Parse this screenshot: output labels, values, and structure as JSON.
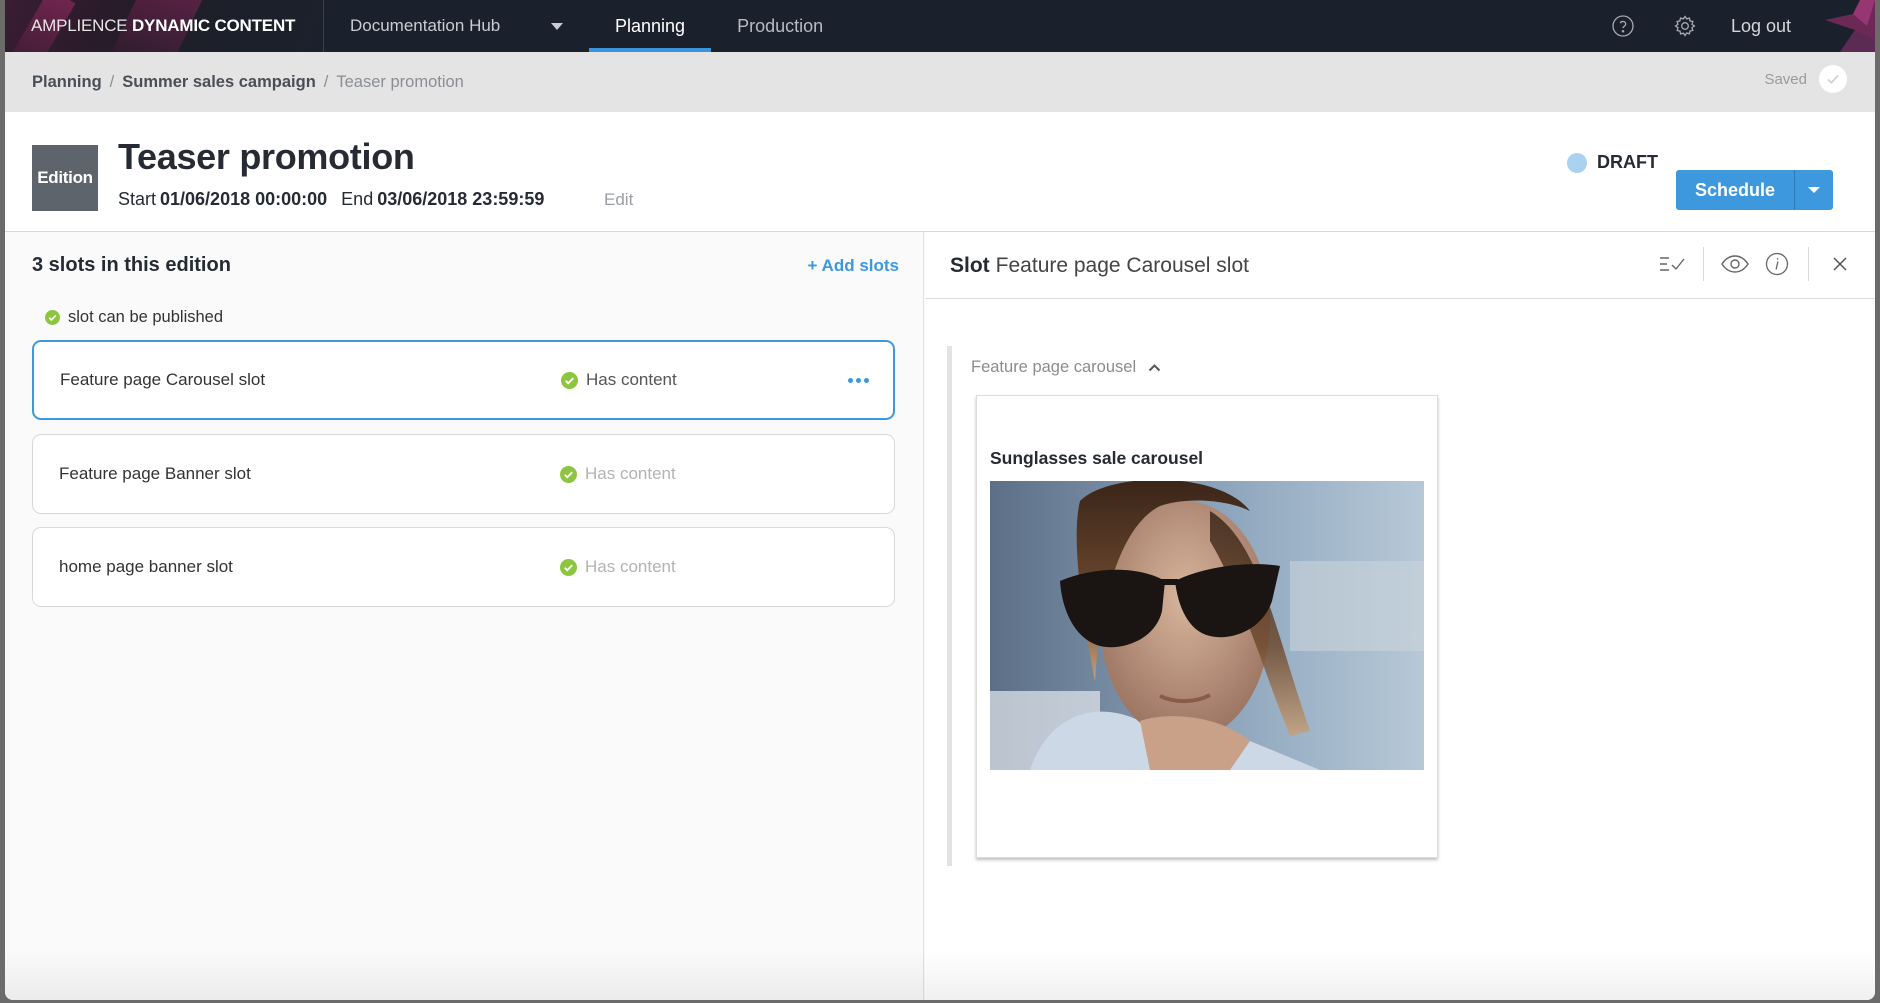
{
  "topnav": {
    "brand_light": "AMPLIENCE",
    "brand_bold": "DYNAMIC CONTENT",
    "hub_name": "Documentation Hub",
    "tabs": [
      {
        "label": "Planning",
        "active": true
      },
      {
        "label": "Production",
        "active": false
      }
    ],
    "help_icon": "help-circle-icon",
    "settings_icon": "gear-icon",
    "logout_label": "Log out"
  },
  "breadcrumb": {
    "items": [
      "Planning",
      "Summer sales campaign",
      "Teaser promotion"
    ],
    "separator": "/",
    "saved_label": "Saved"
  },
  "edition": {
    "badge": "Edition",
    "title": "Teaser promotion",
    "start_label": "Start",
    "start_value": "01/06/2018 00:00:00",
    "end_label": "End",
    "end_value": "03/06/2018 23:59:59",
    "edit_label": "Edit",
    "status": "DRAFT",
    "status_color": "#a8d2ef",
    "schedule_label": "Schedule",
    "accent_color": "#3d98de"
  },
  "slots_panel": {
    "title": "3 slots in this edition",
    "add_label": "+ Add slots",
    "publish_note": "slot can be published",
    "slots": [
      {
        "name": "Feature page Carousel slot",
        "status": "Has content",
        "selected": true
      },
      {
        "name": "Feature page Banner slot",
        "status": "Has content",
        "selected": false
      },
      {
        "name": "home page banner slot",
        "status": "Has content",
        "selected": false
      }
    ]
  },
  "slot_detail": {
    "label": "Slot",
    "name": "Feature page Carousel slot",
    "content_type_label": "Feature page carousel",
    "content_title": "Sunglasses sale carousel",
    "image_alt": "Woman wearing dark sunglasses"
  }
}
